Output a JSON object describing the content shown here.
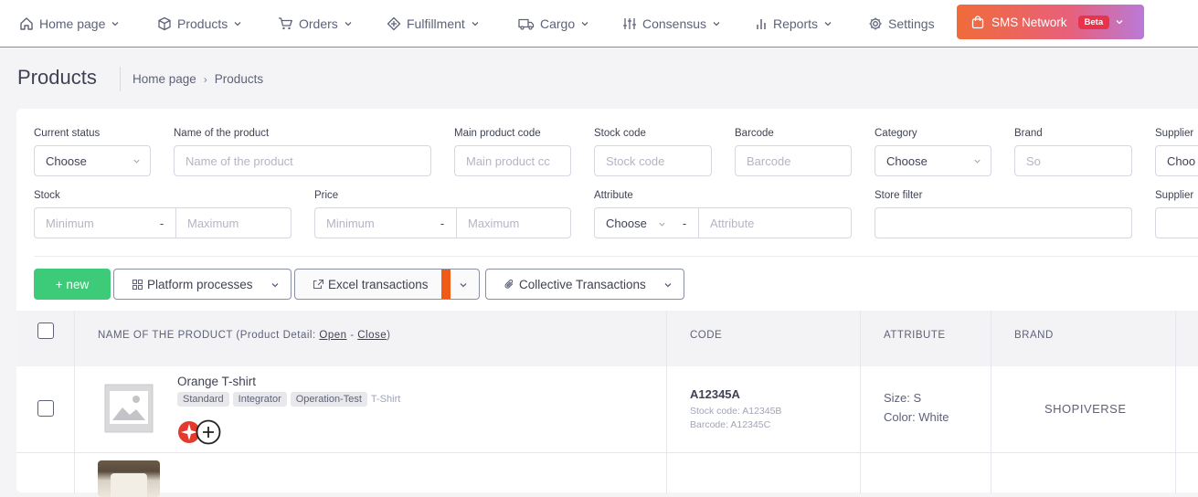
{
  "nav": {
    "items": [
      {
        "label": "Home page",
        "icon": "home-icon"
      },
      {
        "label": "Products",
        "icon": "box-icon"
      },
      {
        "label": "Orders",
        "icon": "cart-icon"
      },
      {
        "label": "Fulfillment",
        "icon": "fulfillment-icon"
      },
      {
        "label": "Cargo",
        "icon": "truck-icon"
      },
      {
        "label": "Consensus",
        "icon": "sliders-icon"
      },
      {
        "label": "Reports",
        "icon": "bar-chart-icon"
      },
      {
        "label": "Settings",
        "icon": "gear-icon"
      }
    ],
    "sms": {
      "label": "SMS Network",
      "badge": "Beta"
    },
    "accent": "#f26b1d"
  },
  "page": {
    "title": "Products",
    "breadcrumb": [
      "Home page",
      "Products"
    ]
  },
  "filters": {
    "current_status": {
      "label": "Current status",
      "value": "Choose"
    },
    "product_name": {
      "label": "Name of the product",
      "placeholder": "Name of the product"
    },
    "main_code": {
      "label": "Main product code",
      "placeholder": "Main product cc"
    },
    "stock_code": {
      "label": "Stock code",
      "placeholder": "Stock code"
    },
    "barcode": {
      "label": "Barcode",
      "placeholder": "Barcode"
    },
    "category": {
      "label": "Category",
      "value": "Choose"
    },
    "brand": {
      "label": "Brand",
      "placeholder": "So"
    },
    "supplier": {
      "label": "Supplier",
      "value": "Choo"
    },
    "stock": {
      "label": "Stock",
      "min": "Minimum",
      "max": "Maximum",
      "dash": "-"
    },
    "price": {
      "label": "Price",
      "min": "Minimum",
      "max": "Maximum",
      "dash": "-"
    },
    "attribute": {
      "label": "Attribute",
      "value": "Choose",
      "placeholder": "Attribute",
      "dash": "-"
    },
    "store_filter": {
      "label": "Store filter"
    },
    "supplier2": {
      "label": "Supplier"
    }
  },
  "actions": {
    "new": "+ new",
    "platform": "Platform processes",
    "excel": "Excel transactions",
    "collective": "Collective Transactions"
  },
  "table": {
    "headers": {
      "name_prefix": "NAME OF THE PRODUCT (Product Detail: ",
      "open": "Open",
      "dash": " - ",
      "close": "Close",
      "suffix": ")",
      "code": "CODE",
      "attribute": "ATTRIBUTE",
      "brand": "BRAND"
    },
    "rows": [
      {
        "name": "Orange T-shirt",
        "tags": [
          "Standard",
          "Integrator",
          "Operation-Test"
        ],
        "type": "T-Shirt",
        "code": "A12345A",
        "stock_code": "Stock code: A12345B",
        "barcode": "Barcode: A12345C",
        "attr_size": "Size: S",
        "attr_color": "Color: White",
        "brand": "SHOPIVERSE"
      }
    ]
  }
}
